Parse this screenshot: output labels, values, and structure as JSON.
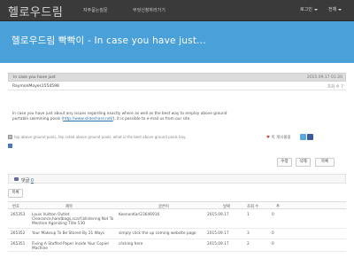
{
  "nav": {
    "brand": "헬로우드림",
    "links": [
      "자주묻는질문",
      "무엇신청하러가기"
    ],
    "login": "로그인",
    "all": "전체"
  },
  "banner": {
    "title": "헬로우드림 빡빡이 - In case you have just..."
  },
  "post": {
    "subject": "In case you have just",
    "datetime": "2015.09.17 01:20",
    "author": "RaymonMoyes1554598",
    "views_label": "조회 수 7",
    "body_line1": "In case you have just about any issues regarding exactly where as well as the best way to employ above ground",
    "body_line2_prefix": "portable swimming pools (",
    "body_link": "http://www.slideshare.net/",
    "body_line2_suffix": "), it is possible to e-mail us from our site.",
    "tags": "top above ground pools, top rated above ground pools, what is the best above ground pools buy,",
    "share_label": "이 게시물을"
  },
  "buttons": {
    "edit": "수정",
    "delete": "삭제",
    "list": "목록"
  },
  "comments": {
    "label": "댓글",
    "count": "0"
  },
  "list_button": "목록",
  "table": {
    "headers": [
      "번호",
      "제목",
      "글쓴이",
      "날짜",
      "조회 수",
      "추"
    ],
    "rows": [
      {
        "no": "265353",
        "title": "Louis Vuitton Outlet Clearance,handbags,scarf,blistering Not To Mention Agonizing Title 530",
        "author": "KeenonKarl23646916",
        "date": "2015.09.17",
        "views": "1",
        "votes": "0"
      },
      {
        "no": "265352",
        "title": "Your Makeup To Be Stored By 21 Ways",
        "author": "simply click the up coming website page",
        "date": "2015.09.17",
        "views": "3",
        "votes": "0"
      },
      {
        "no": "265351",
        "title": "Fixing A Stuffed Paper Inside Your Copier Machine",
        "author": "clicking here",
        "date": "2015.09.17",
        "views": "2",
        "votes": "0"
      }
    ]
  }
}
